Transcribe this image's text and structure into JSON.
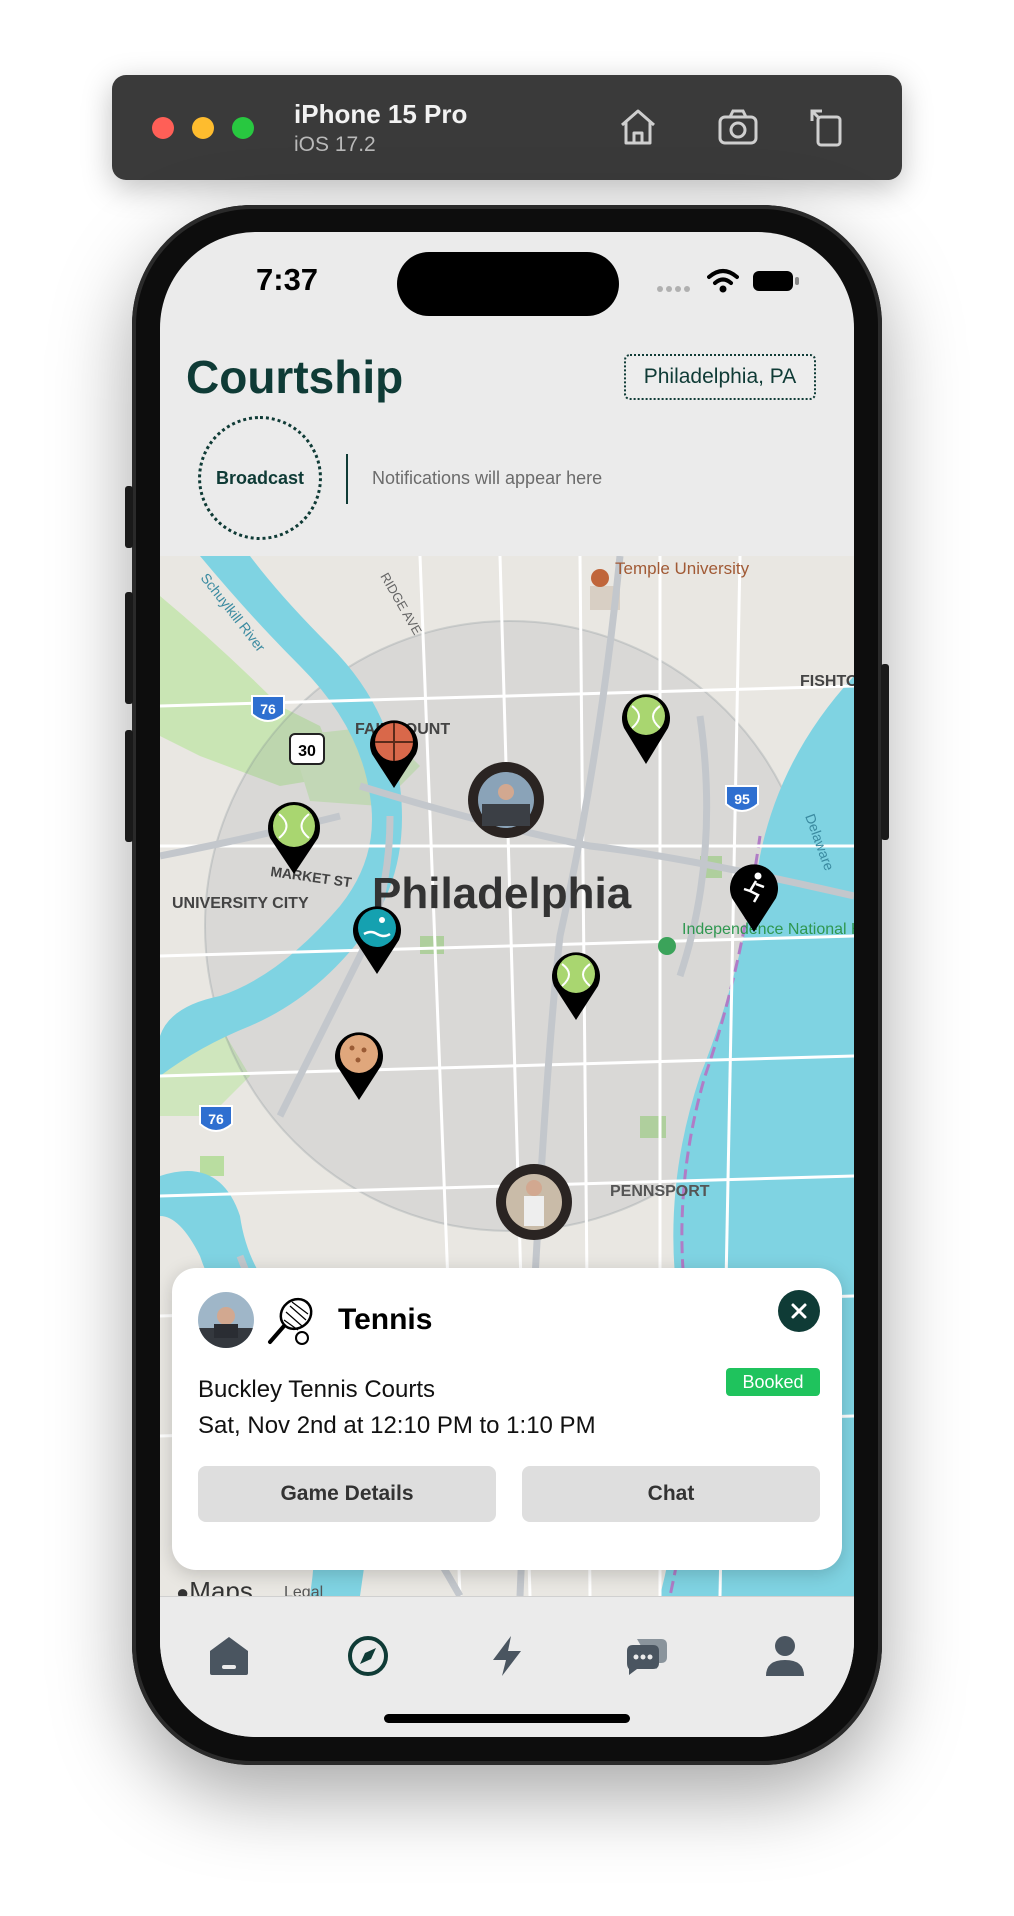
{
  "simulator": {
    "device": "iPhone 15 Pro",
    "os": "iOS 17.2",
    "icons": [
      "home-icon",
      "screenshot-icon",
      "rotate-icon"
    ]
  },
  "status_bar": {
    "time": "7:37"
  },
  "header": {
    "app_title": "Courtship",
    "location": "Philadelphia, PA"
  },
  "broadcast": {
    "label": "Broadcast",
    "notifications_placeholder": "Notifications will appear here"
  },
  "map": {
    "labels": {
      "city": "Philadelphia",
      "temple": "Temple University",
      "fairmount": "FAIRMOUNT",
      "market": "MARKET ST",
      "university_city": "UNIVERSITY CITY",
      "independence": "Independence National Historical Park",
      "pennsport": "PENNSPORT",
      "fishtown": "FISHTO",
      "schuylkill": "Schuylkill River",
      "ridge": "RIDGE AVE",
      "delaware": "Delaware"
    },
    "shields": {
      "i76_top": "76",
      "us30": "30",
      "i95": "95",
      "i76_bottom": "76"
    },
    "pins": [
      {
        "sport": "basketball",
        "icon": "basketball-icon"
      },
      {
        "sport": "tennis",
        "icon": "tennis-ball-icon"
      },
      {
        "sport": "tennis",
        "icon": "tennis-ball-icon"
      },
      {
        "sport": "swimming",
        "icon": "swimmer-icon"
      },
      {
        "sport": "running",
        "icon": "runner-icon"
      },
      {
        "sport": "tennis",
        "icon": "tennis-ball-icon"
      },
      {
        "sport": "pickleball",
        "icon": "pickleball-icon"
      }
    ],
    "attribution": {
      "logo": "Maps",
      "legal": "Legal"
    }
  },
  "game_card": {
    "sport": "Tennis",
    "status": "Booked",
    "venue": "Buckley Tennis Courts",
    "time": "Sat, Nov 2nd at 12:10 PM to 1:10 PM",
    "details_label": "Game Details",
    "chat_label": "Chat"
  },
  "tabbar": {
    "items": [
      {
        "name": "home",
        "icon": "home-icon"
      },
      {
        "name": "explore",
        "icon": "compass-icon",
        "active": true
      },
      {
        "name": "activity",
        "icon": "lightning-icon"
      },
      {
        "name": "messages",
        "icon": "chat-icon"
      },
      {
        "name": "profile",
        "icon": "person-icon"
      }
    ]
  },
  "colors": {
    "brand": "#0f3b36",
    "booked": "#1fc35d",
    "background": "#ebebeb"
  }
}
